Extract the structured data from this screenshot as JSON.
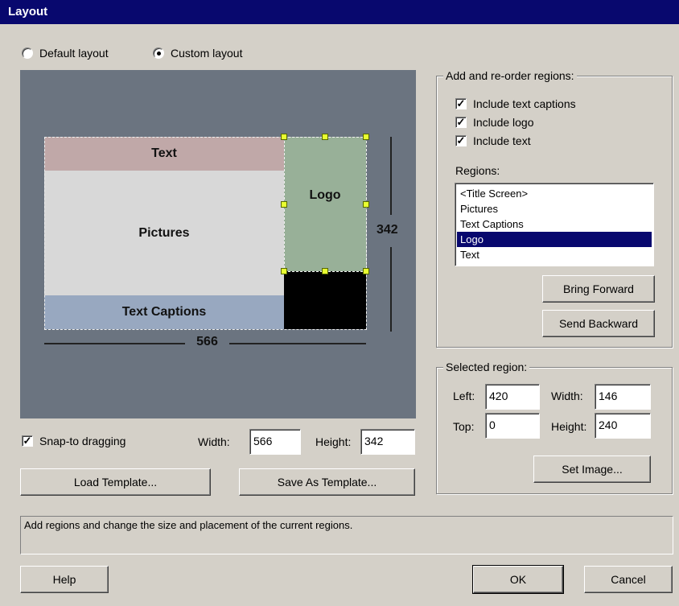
{
  "window": {
    "title": "Layout"
  },
  "layout_mode": {
    "default_label": "Default layout",
    "custom_label": "Custom layout",
    "selected": "custom"
  },
  "preview": {
    "regions": {
      "text": "Text",
      "pictures": "Pictures",
      "logo": "Logo",
      "captions": "Text Captions"
    },
    "width_dim": "566",
    "height_dim": "342",
    "colors": {
      "background": "#6b7480",
      "text_region": "#c0a8a8",
      "pictures_region": "#d8d8d8",
      "logo_region": "#98b098",
      "captions_region": "#98a8c0",
      "black_region": "#000000"
    }
  },
  "snap": {
    "label": "Snap-to dragging",
    "checked": true
  },
  "size": {
    "width_label": "Width:",
    "width_value": "566",
    "height_label": "Height:",
    "height_value": "342"
  },
  "template_buttons": {
    "load": "Load Template...",
    "save": "Save As Template..."
  },
  "regions_group": {
    "title": "Add and re-order regions:",
    "include_captions": {
      "label": "Include text captions",
      "checked": true
    },
    "include_logo": {
      "label": "Include logo",
      "checked": true
    },
    "include_text": {
      "label": "Include text",
      "checked": true
    },
    "regions_label": "Regions:",
    "list": [
      "<Title Screen>",
      "Pictures",
      "Text Captions",
      "Logo",
      "Text"
    ],
    "selected_index": 3,
    "bring_forward": "Bring Forward",
    "send_backward": "Send Backward"
  },
  "selected_region": {
    "title": "Selected region:",
    "left_label": "Left:",
    "left_value": "420",
    "top_label": "Top:",
    "top_value": "0",
    "width_label": "Width:",
    "width_value": "146",
    "height_label": "Height:",
    "height_value": "240",
    "set_image": "Set Image..."
  },
  "status_text": "Add regions and change the size and placement of the current regions.",
  "footer": {
    "help": "Help",
    "ok": "OK",
    "cancel": "Cancel"
  }
}
